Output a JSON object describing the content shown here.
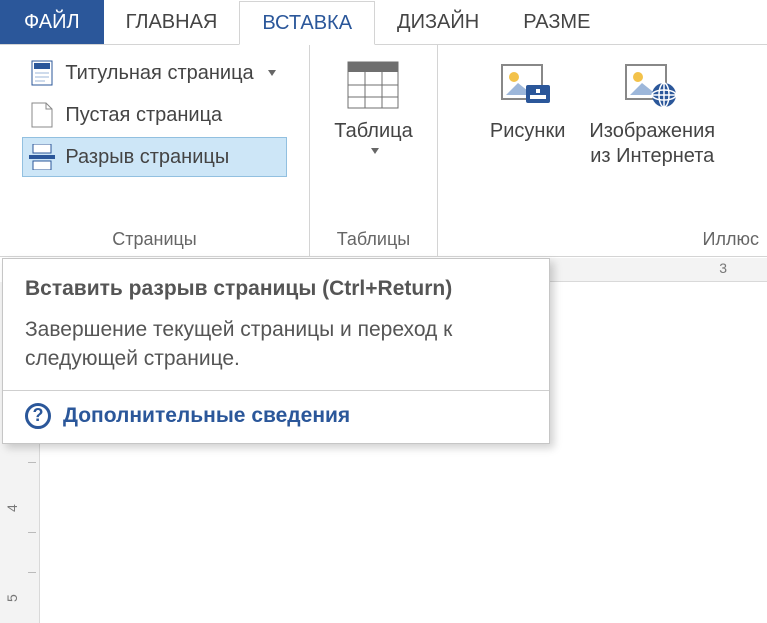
{
  "tabs": {
    "file": "ФАЙЛ",
    "home": "ГЛАВНАЯ",
    "insert": "ВСТАВКА",
    "design": "ДИЗАЙН",
    "layout": "РАЗМЕ"
  },
  "ribbon": {
    "pages": {
      "group_label": "Страницы",
      "cover_page": "Титульная страница",
      "blank_page": "Пустая страница",
      "page_break": "Разрыв страницы"
    },
    "tables": {
      "group_label": "Таблицы",
      "table": "Таблица"
    },
    "illustrations": {
      "group_label": "Иллюс",
      "pictures": "Рисунки",
      "online_pictures_l1": "Изображения",
      "online_pictures_l2": "из Интернета"
    }
  },
  "screentip": {
    "title": "Вставить разрыв страницы (Ctrl+Return)",
    "description": "Завершение текущей страницы и переход к следующей странице.",
    "more": "Дополнительные сведения"
  },
  "ruler": {
    "h_visible": "3",
    "v4": "4",
    "v5": "5"
  }
}
